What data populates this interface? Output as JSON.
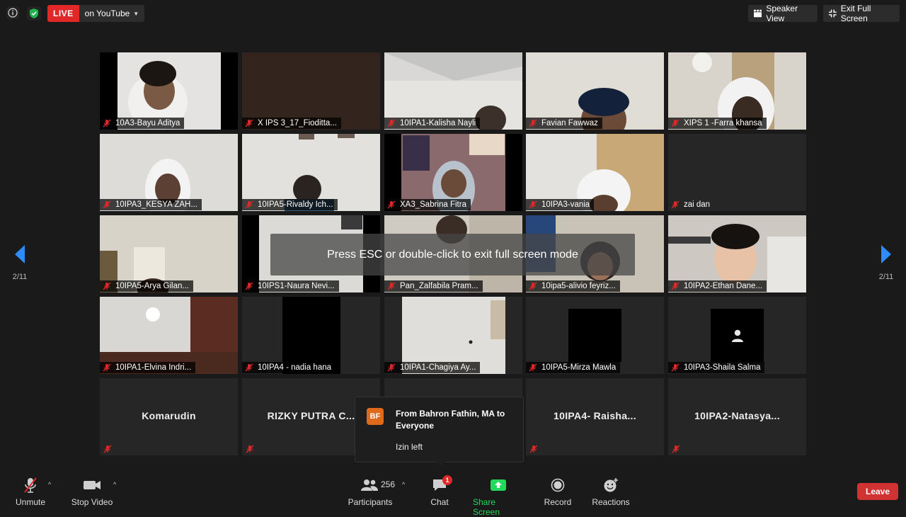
{
  "top_bar": {
    "live_label": "LIVE",
    "stream_destination": "on YouTube",
    "speaker_view_label": "Speaker View",
    "exit_full_screen_label": "Exit Full Screen"
  },
  "navigation": {
    "page_indicator": "2/11"
  },
  "participants_grid": [
    {
      "name": "10A3-Bayu Aditya"
    },
    {
      "name": "X IPS 3_17_Fioditta..."
    },
    {
      "name": "10IPA1-Kalisha Nayli"
    },
    {
      "name": "Favian Fawwaz"
    },
    {
      "name": "XIPS 1 -Farra khansa"
    },
    {
      "name": "10IPA3_KESYA ZAH..."
    },
    {
      "name": "10IPA5-Rivaldy Ich..."
    },
    {
      "name": "XA3_Sabrina Fitra"
    },
    {
      "name": "10IPA3-vania"
    },
    {
      "name": "zai dan"
    },
    {
      "name": "10IPA5-Arya Gilan..."
    },
    {
      "name": "10IPS1-Naura Nevi..."
    },
    {
      "name": "Pan_Zalfabila Pram..."
    },
    {
      "name": "10ipa5-alivio feyriz..."
    },
    {
      "name": "10IPA2-Ethan Dane..."
    },
    {
      "name": "10IPA1-Elvina Indri..."
    },
    {
      "name": "10IPA4 - nadia hana"
    },
    {
      "name": "10IPA1-Chagiya Ay..."
    },
    {
      "name": "10IPA5-Mirza Mawla"
    },
    {
      "name": "10IPA3-Shaila Salma"
    },
    {
      "name": "Komarudin"
    },
    {
      "name": "RIZKY PUTRA C..."
    },
    {
      "name": ""
    },
    {
      "name": "10IPA4- Raisha..."
    },
    {
      "name": "10IPA2-Natasya..."
    }
  ],
  "fullscreen_hint": "Press ESC or double-click to exit full screen mode",
  "chat_notification": {
    "avatar_initials": "BF",
    "from": "From Bahron Fathin, MA to Everyone",
    "message": "Izin left"
  },
  "toolbar": {
    "unmute_label": "Unmute",
    "stop_video_label": "Stop Video",
    "participants_label": "Participants",
    "participants_count": "256",
    "chat_label": "Chat",
    "chat_badge": "1",
    "share_screen_label": "Share Screen",
    "record_label": "Record",
    "reactions_label": "Reactions",
    "leave_label": "Leave"
  },
  "colors": {
    "accent_blue": "#2d8cff",
    "live_red": "#e02828",
    "share_green": "#23d959",
    "leave_red": "#d13232",
    "avatar_orange": "#e06a1b"
  }
}
